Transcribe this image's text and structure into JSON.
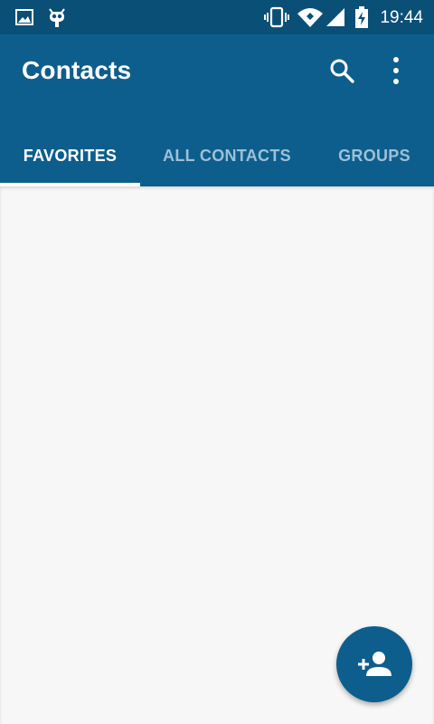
{
  "status_bar": {
    "time": "19:44",
    "icons": [
      "image-icon",
      "cyanogen-mascot-icon",
      "vibrate-icon",
      "wifi-icon",
      "cell-signal-icon",
      "battery-charging-icon"
    ]
  },
  "app_bar": {
    "title": "Contacts",
    "actions": [
      "search-icon",
      "more-vert-icon"
    ]
  },
  "tabs": [
    {
      "label": "FAVORITES",
      "active": true
    },
    {
      "label": "ALL CONTACTS",
      "active": false
    },
    {
      "label": "GROUPS",
      "active": false
    }
  ],
  "fab": {
    "icon": "add-person-icon"
  },
  "colors": {
    "status_bar": "#0a4f76",
    "primary": "#0d5e8c",
    "background": "#f7f7f7",
    "tab_inactive": "#9ec0d6",
    "tab_active": "#ffffff"
  }
}
